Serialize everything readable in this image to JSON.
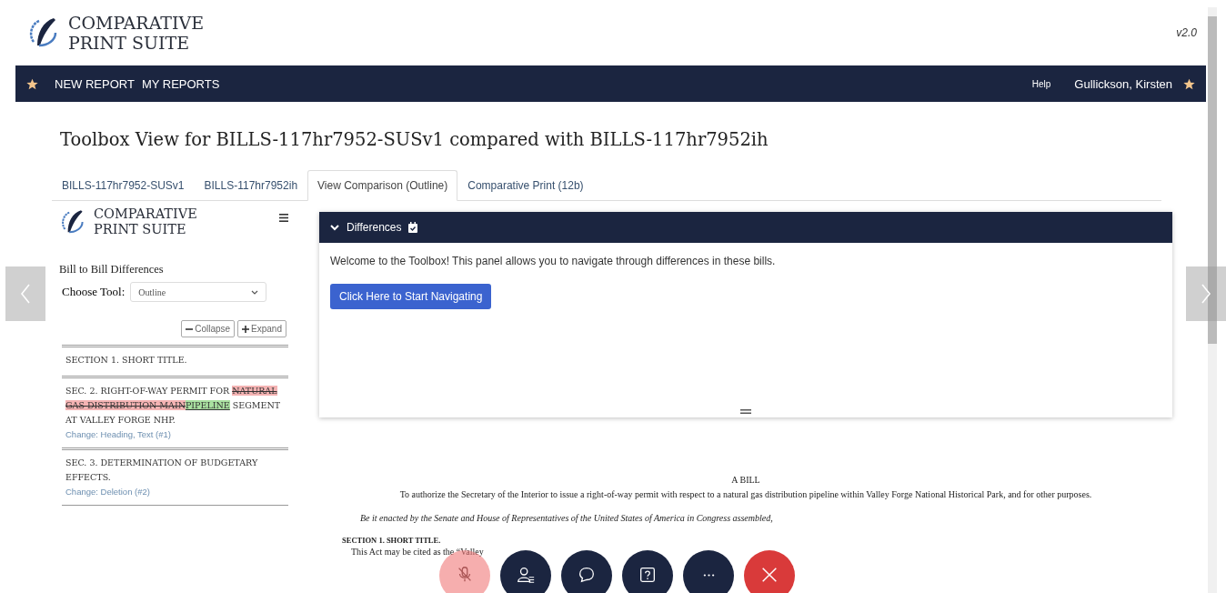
{
  "header": {
    "logo_line_1": "COMPARATIVE",
    "logo_line_2": "PRINT SUITE",
    "version": "v2.0"
  },
  "nav": {
    "items": [
      "NEW REPORT",
      "MY REPORTS"
    ],
    "help": "Help",
    "user": "Gullickson, Kirsten"
  },
  "title": "Toolbox View for BILLS-117hr7952-SUSv1 compared with BILLS-117hr7952ih",
  "tabs": [
    {
      "label": "BILLS-117hr7952-SUSv1",
      "selected": false
    },
    {
      "label": "BILLS-117hr7952ih",
      "selected": false
    },
    {
      "label": "View Comparison (Outline)",
      "selected": true
    },
    {
      "label": "Comparative Print (12b)",
      "selected": false
    }
  ],
  "sidebar": {
    "logo_line_1": "COMPARATIVE",
    "logo_line_2": "PRINT SUITE",
    "heading": "Bill to Bill Differences",
    "tool_label": "Choose Tool:",
    "tool_value": "Outline",
    "collapse": "Collapse",
    "expand": "Expand",
    "sections": [
      {
        "segments": [
          {
            "kind": "plain",
            "text": "SECTION 1. SHORT TITLE."
          }
        ]
      },
      {
        "segments": [
          {
            "kind": "plain",
            "text": "SEC. 2. RIGHT-OF-WAY PERMIT FOR "
          },
          {
            "kind": "deleted",
            "text": "NATURAL GAS DISTRIBUTION MAIN"
          },
          {
            "kind": "inserted",
            "text": "PIPELINE"
          },
          {
            "kind": "plain",
            "text": " SEGMENT AT VALLEY FORGE NHP."
          }
        ],
        "change": "Change: Heading, Text (#1)"
      },
      {
        "segments": [
          {
            "kind": "plain",
            "text": "SEC. 3. DETERMINATION OF BUDGETARY EFFECTS."
          }
        ],
        "change": "Change: Deletion (#2)"
      }
    ]
  },
  "panel": {
    "title": "Differences",
    "expanded": true,
    "message": "Welcome to the Toolbox! This panel allows you to navigate through differences in these bills.",
    "button": "Click Here to Start Navigating"
  },
  "bill": {
    "heading": "A BILL",
    "purpose": "To authorize the Secretary of the Interior to issue a right-of-way permit with respect to a natural gas distribution pipeline within Valley Forge National Historical Park, and for other purposes.",
    "enacting": "Be it enacted by the Senate and House of Representatives of the United States of America in Congress assembled,",
    "section_title": "SECTION 1. SHORT TITLE.",
    "section_text": "This Act may be cited as the “Valley"
  },
  "call_controls": [
    {
      "kind": "mic"
    },
    {
      "kind": "people"
    },
    {
      "kind": "chat"
    },
    {
      "kind": "help"
    },
    {
      "kind": "more"
    },
    {
      "kind": "end"
    }
  ]
}
